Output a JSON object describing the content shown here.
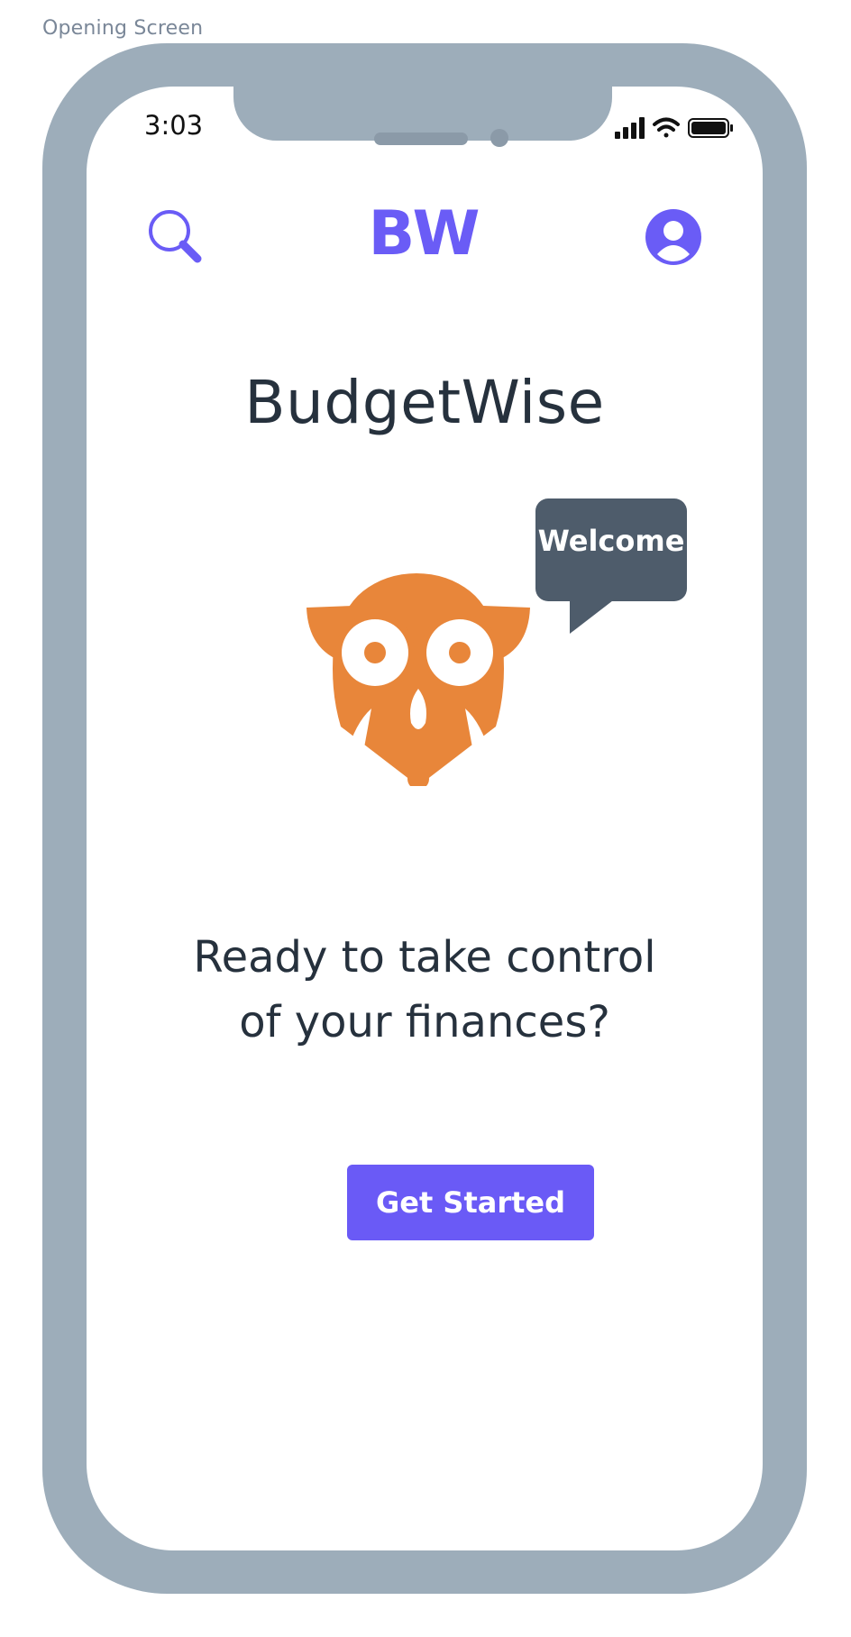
{
  "frame": {
    "label": "Opening Screen"
  },
  "status_bar": {
    "time": "3:03"
  },
  "header": {
    "logo_text": "BW"
  },
  "main": {
    "app_name": "BudgetWise",
    "speech_bubble": "Welcome",
    "tagline_line1": "Ready to take control",
    "tagline_line2": "of your finances?",
    "cta_label": "Get Started"
  },
  "icons": {
    "search": "search-icon",
    "profile": "profile-icon",
    "mascot": "owl-icon",
    "signal": "signal-icon",
    "wifi": "wifi-icon",
    "battery": "battery-icon"
  },
  "colors": {
    "accent": "#6a5cf6",
    "mascot": "#e8863a",
    "bubble": "#4e5c6b",
    "text": "#26313d",
    "device_frame": "#9dadba"
  }
}
